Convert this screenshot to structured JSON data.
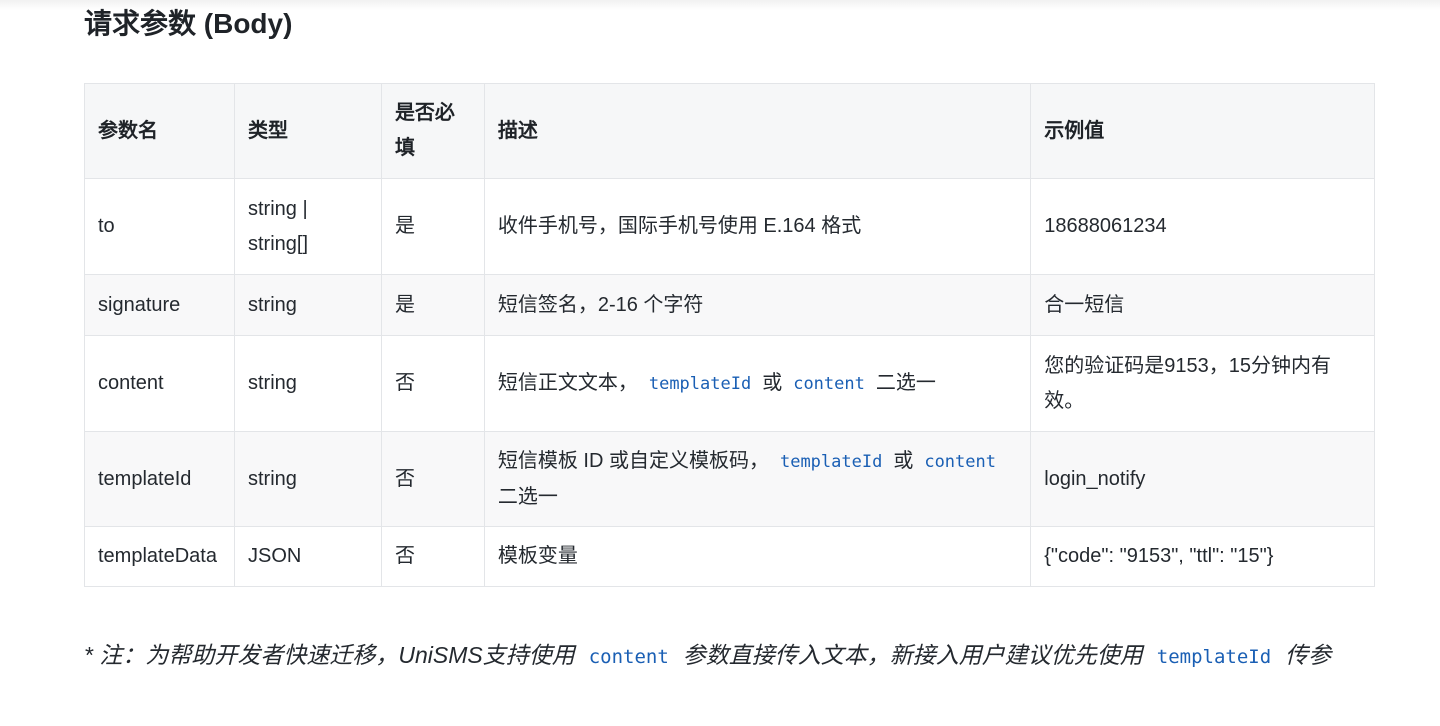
{
  "section": {
    "title": "请求参数 (Body)"
  },
  "table": {
    "headers": {
      "name": "参数名",
      "type": "类型",
      "required": "是否必填",
      "description": "描述",
      "example": "示例值"
    },
    "rows": [
      {
        "name": "to",
        "type": "string | string[]",
        "required": "是",
        "description": "收件手机号，国际手机号使用 E.164 格式",
        "example": "18688061234"
      },
      {
        "name": "signature",
        "type": "string",
        "required": "是",
        "description": "短信签名，2-16 个字符",
        "example": "合一短信"
      },
      {
        "name": "content",
        "type": "string",
        "required": "否",
        "description_prefix": "短信正文文本，",
        "code1": "templateId",
        "connector": "或",
        "code2": "content",
        "description_suffix": "二选一",
        "example": "您的验证码是9153，15分钟内有效。"
      },
      {
        "name": "templateId",
        "type": "string",
        "required": "否",
        "description_prefix": "短信模板 ID 或自定义模板码，",
        "code1": "templateId",
        "connector": "或",
        "code2": "content",
        "description_suffix": "二选一",
        "example": "login_notify"
      },
      {
        "name": "templateData",
        "type": "JSON",
        "required": "否",
        "description": "模板变量",
        "example": "{\"code\": \"9153\", \"ttl\": \"15\"}"
      }
    ]
  },
  "note": {
    "part1": "* 注：为帮助开发者快速迁移，UniSMS支持使用",
    "code1": "content",
    "part2": "参数直接传入文本，新接入用户建议优先使用",
    "code2": "templateId",
    "part3": "传参"
  }
}
